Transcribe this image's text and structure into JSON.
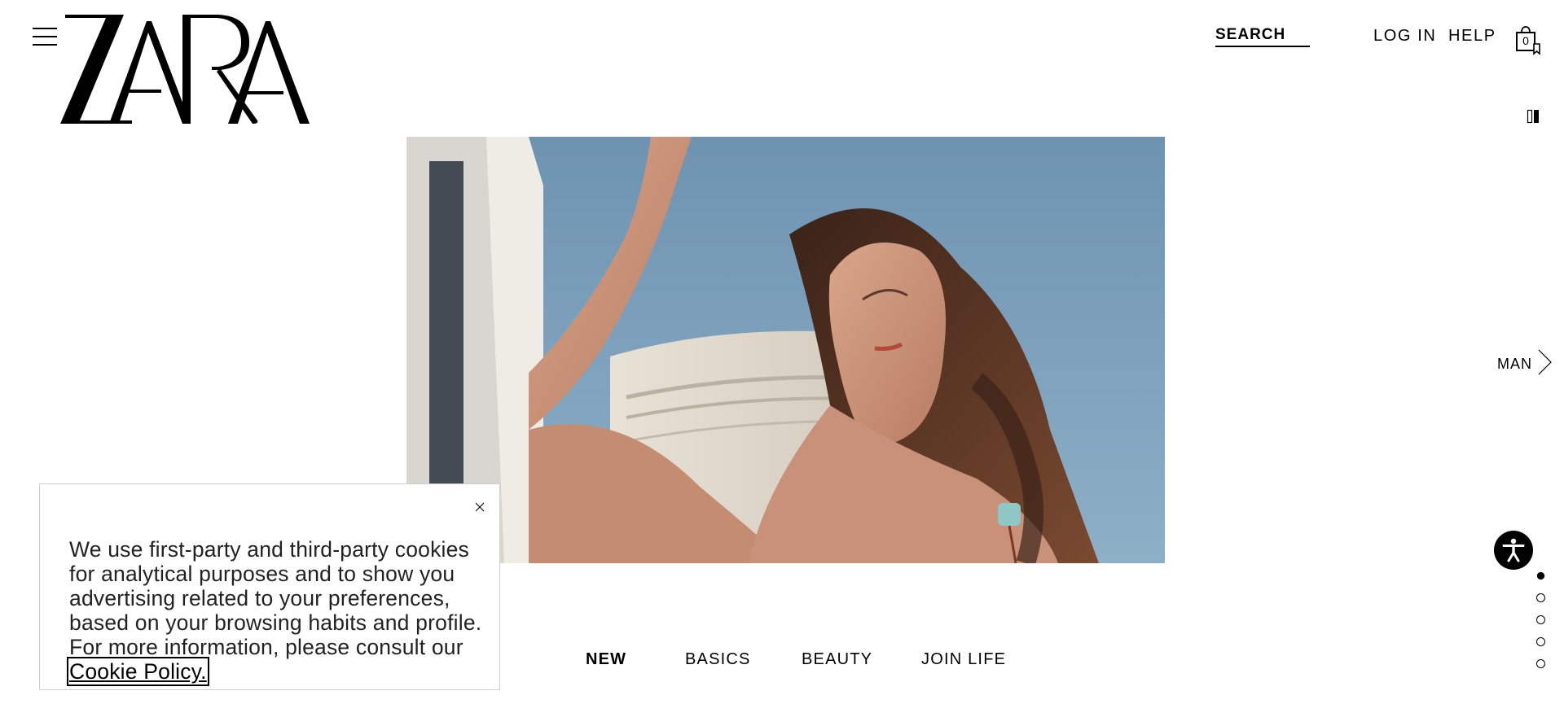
{
  "header": {
    "brand": "ZARA",
    "search_label": "SEARCH",
    "login_label": "LOG IN",
    "help_label": "HELP",
    "bag_count": "0"
  },
  "side": {
    "man_label": "MAN",
    "slide_count": 5,
    "active_slide": 1
  },
  "categories": [
    {
      "label": "NEW",
      "active": true
    },
    {
      "label": "BASICS",
      "active": false
    },
    {
      "label": "BEAUTY",
      "active": false
    },
    {
      "label": "JOIN LIFE",
      "active": false
    }
  ],
  "cookie": {
    "text": "We use first-party and third-party cookies for analytical purposes and to show you advertising related to your preferences, based on your browsing habits and profile. For more information, please consult our ",
    "link_label": "Cookie Policy."
  },
  "icons": {
    "menu": "hamburger-menu-icon",
    "bag": "shopping-bag-icon",
    "view": "grid-view-toggle-icon",
    "next": "chevron-right-icon",
    "accessibility": "accessibility-icon",
    "close": "close-icon"
  },
  "colors": {
    "text": "#000000",
    "background": "#ffffff",
    "banner_border": "#cfcfcf"
  }
}
